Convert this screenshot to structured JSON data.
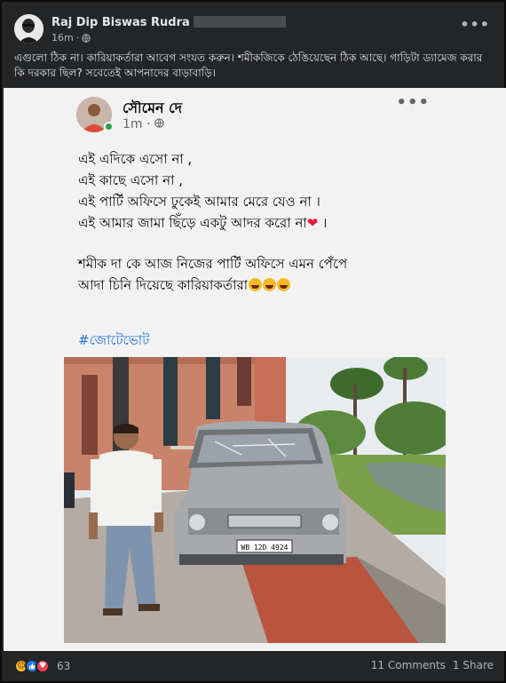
{
  "post": {
    "author": "Raj Dip Biswas Rudra",
    "time": "16m",
    "privacy_icon": "globe-icon",
    "caption": "এগুলো ঠিক না। কারিয়াকর্তারা আবেগ সংযত করুন। শমীকজিকে ঠেঙিয়েছেন ঠিক আছে। গাড়িটা ড্যামেজ করার কি দরকার ছিল? সবেতেই আপনাদের বাড়াবাড়ি।",
    "more_label": "•••"
  },
  "shared": {
    "author": "সৌমেন দে",
    "time": "1m",
    "more_label": "•••",
    "lines": [
      "এই এদিকে এসো না ,",
      "এই কাছে এসো না ,",
      "এই পার্টি অফিসে ঢুকেই আমার মেরে যেও না ।",
      "এই আমার জামা ছিঁড়ে একটু আদর করো না"
    ],
    "line4_tail": " ।",
    "heart": "❤",
    "lines2": [
      "শমীক দা কে আজ  নিজের পার্টি অফিসে এমন পেঁপে",
      "আদা চিনি দিয়েছে কারিয়াকর্তারা"
    ],
    "hashtag": "#জোটেভোট",
    "photo_plate": "WB 12D 4924"
  },
  "footer": {
    "reaction_icons": [
      "haha-icon",
      "like-icon",
      "love-icon"
    ],
    "reaction_count": "63",
    "comments": "11 Comments",
    "shares": "1 Share"
  },
  "colors": {
    "background": "#242526",
    "text": "#e4e6eb",
    "muted": "#b0b3b8",
    "hashtag": "#216fdb",
    "like": "#2078f4",
    "love": "#f33e58",
    "haha": "#f7b928"
  }
}
